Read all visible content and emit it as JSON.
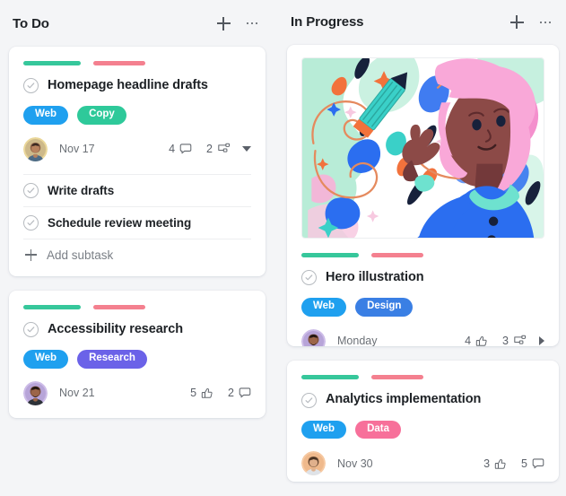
{
  "board": {
    "background_color": "#f4f5f7",
    "columns": [
      {
        "id": "todo",
        "title": "To Do",
        "add_icon": "plus-icon",
        "menu_icon": "ellipsis-icon",
        "cards": [
          {
            "id": "homepage-headline-drafts",
            "bars": [
              {
                "color": "#36c79b",
                "name": "progress-bar-green"
              },
              {
                "color": "#f4808f",
                "name": "progress-bar-pink"
              }
            ],
            "title": "Homepage headline drafts",
            "status_icon": "check-circle-icon",
            "tags": [
              {
                "label": "Web",
                "color": "#1fa0ef"
              },
              {
                "label": "Copy",
                "color": "#2ec99a"
              }
            ],
            "assignee_ring_color": "#ead79a",
            "date": "Nov 17",
            "stats": [
              {
                "value": "4",
                "icon": "comment-icon"
              },
              {
                "value": "2",
                "icon": "subtask-icon"
              }
            ],
            "expander_icon": "caret-down-icon",
            "subtasks": [
              {
                "label": "Write drafts",
                "icon": "check-circle-icon"
              },
              {
                "label": "Schedule review meeting",
                "icon": "check-circle-icon"
              }
            ],
            "add_subtask_label": "Add subtask",
            "add_subtask_icon": "plus-icon"
          },
          {
            "id": "accessibility-research",
            "bars": [
              {
                "color": "#36c79b",
                "name": "progress-bar-green"
              },
              {
                "color": "#f4808f",
                "name": "progress-bar-pink"
              }
            ],
            "title": "Accessibility research",
            "status_icon": "check-circle-icon",
            "tags": [
              {
                "label": "Web",
                "color": "#1fa0ef"
              },
              {
                "label": "Research",
                "color": "#6b62e8"
              }
            ],
            "assignee_ring_color": "#cdbde8",
            "date": "Nov 21",
            "stats": [
              {
                "value": "5",
                "icon": "thumbs-up-icon"
              },
              {
                "value": "2",
                "icon": "comment-icon"
              }
            ]
          }
        ]
      },
      {
        "id": "in-progress",
        "title": "In Progress",
        "add_icon": "plus-icon",
        "menu_icon": "ellipsis-icon",
        "cards": [
          {
            "id": "hero-illustration",
            "cover_icon": "illustration-cover",
            "cover_alt": "Illustration of a person with pink hair holding a large pencil",
            "bars": [
              {
                "color": "#36c79b",
                "name": "progress-bar-green"
              },
              {
                "color": "#f4808f",
                "name": "progress-bar-pink"
              }
            ],
            "title": "Hero illustration",
            "status_icon": "check-circle-icon",
            "tags": [
              {
                "label": "Web",
                "color": "#1fa0ef"
              },
              {
                "label": "Design",
                "color": "#3a7fe4"
              }
            ],
            "assignee_ring_color": "#cdbde8",
            "date": "Monday",
            "stats": [
              {
                "value": "4",
                "icon": "thumbs-up-icon"
              },
              {
                "value": "3",
                "icon": "subtask-icon"
              }
            ],
            "expander_icon": "caret-right-icon"
          },
          {
            "id": "analytics-implementation",
            "bars": [
              {
                "color": "#36c79b",
                "name": "progress-bar-green"
              },
              {
                "color": "#f4808f",
                "name": "progress-bar-pink"
              }
            ],
            "title": "Analytics implementation",
            "status_icon": "check-circle-icon",
            "tags": [
              {
                "label": "Web",
                "color": "#1fa0ef"
              },
              {
                "label": "Data",
                "color": "#f7709a"
              }
            ],
            "assignee_ring_color": "#f6c9a2",
            "date": "Nov 30",
            "stats": [
              {
                "value": "3",
                "icon": "thumbs-up-icon"
              },
              {
                "value": "5",
                "icon": "comment-icon"
              }
            ]
          }
        ]
      }
    ]
  }
}
